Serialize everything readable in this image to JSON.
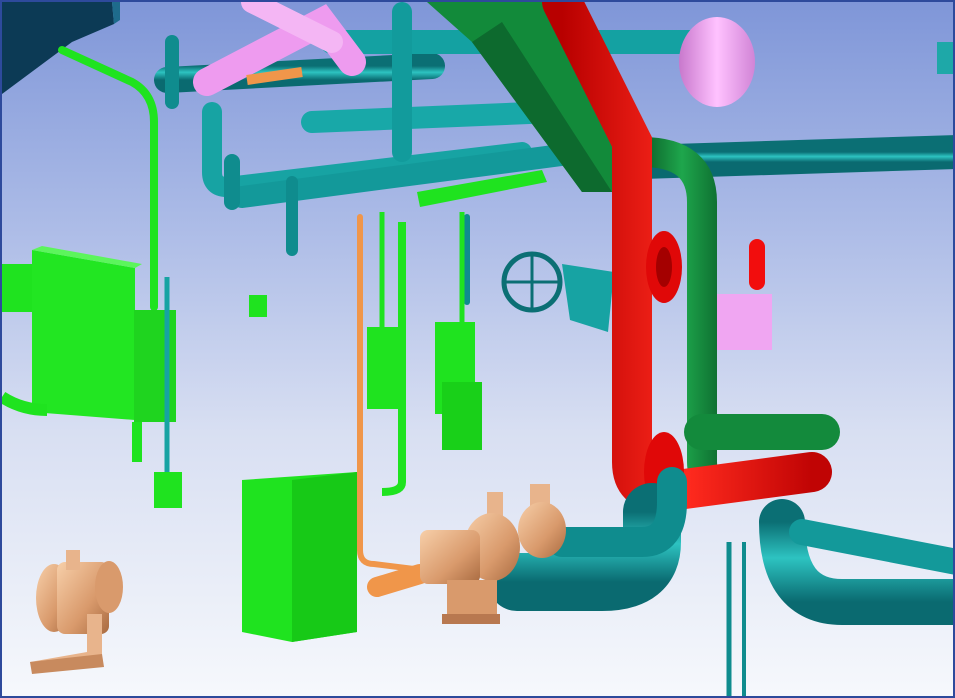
{
  "scene": {
    "colors": {
      "teal": "#15a0a0",
      "teal_dark": "#0b6f74",
      "red": "#f20d0d",
      "dark_green": "#138a3c",
      "pink": "#ee9bef",
      "orange": "#f0964a",
      "bright_green": "#1fe31f",
      "pump_tan": "#e8b48c",
      "navy_block": "#0c3a55"
    },
    "icons": {
      "pump": "pump-icon",
      "valve": "valve-handwheel-icon"
    }
  }
}
